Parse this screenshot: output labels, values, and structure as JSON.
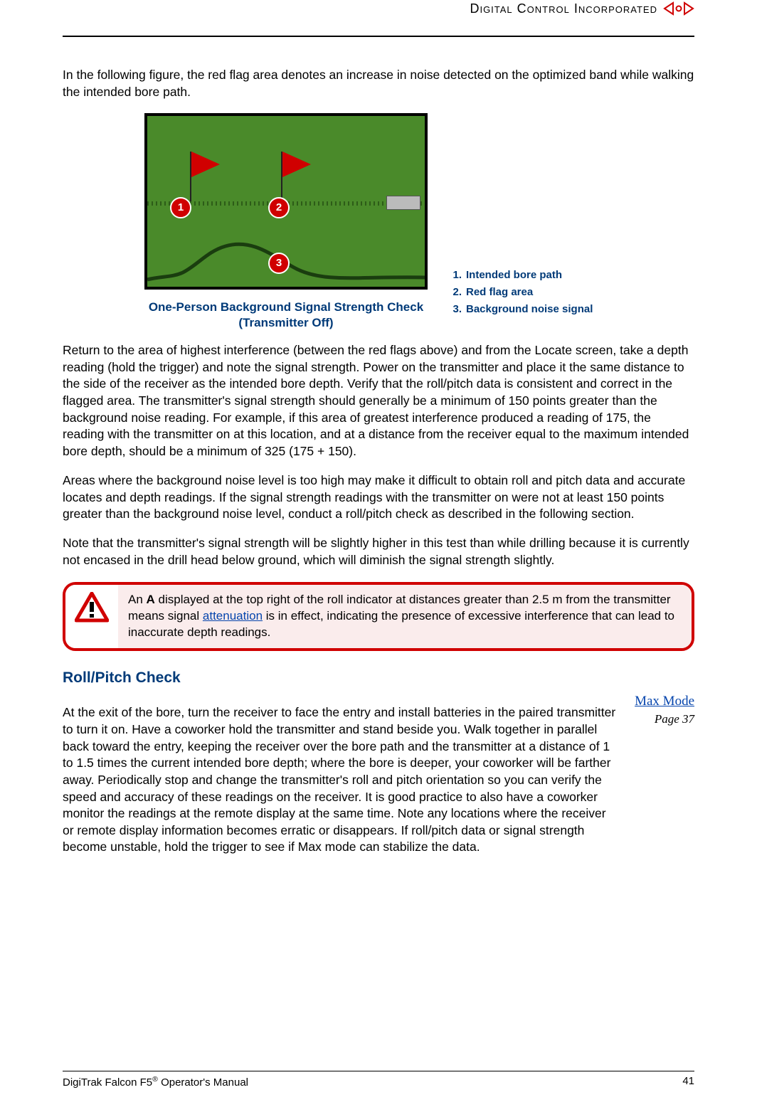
{
  "header": {
    "company": "Digital Control Incorporated"
  },
  "intro": "In the following figure, the red flag area denotes an increase in noise detected on the optimized band while walking the intended bore path.",
  "figure": {
    "caption_line1": "One-Person Background Signal Strength Check",
    "caption_line2": "(Transmitter Off)",
    "bubbles": {
      "b1": "1",
      "b2": "2",
      "b3": "3"
    }
  },
  "legend": [
    {
      "num": "1.",
      "text": "Intended bore path"
    },
    {
      "num": "2.",
      "text": "Red flag area"
    },
    {
      "num": "3.",
      "text": "Background noise signal"
    }
  ],
  "p1": "Return to the area of highest interference (between the red flags above) and from the Locate screen, take a depth reading (hold the trigger) and note the signal strength. Power on the transmitter and place it the same distance to the side of the receiver as the intended bore depth. Verify that the roll/pitch data is consistent and correct in the flagged area. The transmitter's signal strength should generally be a minimum of 150 points greater than the background noise reading. For example, if this area of greatest interference produced a reading of 175, the reading with the transmitter on at this location, and at a distance from the receiver equal to the maximum intended bore depth, should be a minimum of 325 (175 + 150).",
  "p2": "Areas where the background noise level is too high may make it difficult to obtain roll and pitch data and accurate locates and depth readings. If the signal strength readings with the transmitter on were not at least 150 points greater than the background noise level, conduct a roll/pitch check as described in the following section.",
  "p3": "Note that the transmitter's signal strength will be slightly higher in this test than while drilling because it is currently not encased in the drill head below ground, which will diminish the signal strength slightly.",
  "warning": {
    "pre": "An ",
    "bold": "A",
    "mid": " displayed at the top right of the roll indicator at distances greater than 2.5 m from the transmitter means signal ",
    "link": "attenuation",
    "post": " is in effect, indicating the presence of excessive interference that can lead to inaccurate depth readings."
  },
  "section_head": "Roll/Pitch Check",
  "roll_pitch": "At the exit of the bore, turn the receiver to face the entry and install batteries in the paired transmitter to turn it on. Have a coworker hold the transmitter and stand beside you. Walk together in parallel back toward the entry, keeping the receiver over the bore path and the transmitter at a distance of 1 to 1.5 times the current intended bore depth; where the bore is deeper, your coworker will be farther away. Periodically stop and change the transmitter's roll and pitch orientation so you can verify the speed and accuracy of these readings on the receiver. It is good practice to also have a coworker monitor the readings at the remote display at the same time. Note any locations where the receiver or remote display information becomes erratic or disappears. If roll/pitch data or signal strength become unstable, hold the trigger to see if Max mode can stabilize the data.",
  "side": {
    "link": "Max Mode",
    "page_label": "Page ",
    "page_num": "37"
  },
  "footer": {
    "left_pre": "DigiTrak Falcon F5",
    "left_post": " Operator's Manual",
    "right": "41"
  }
}
